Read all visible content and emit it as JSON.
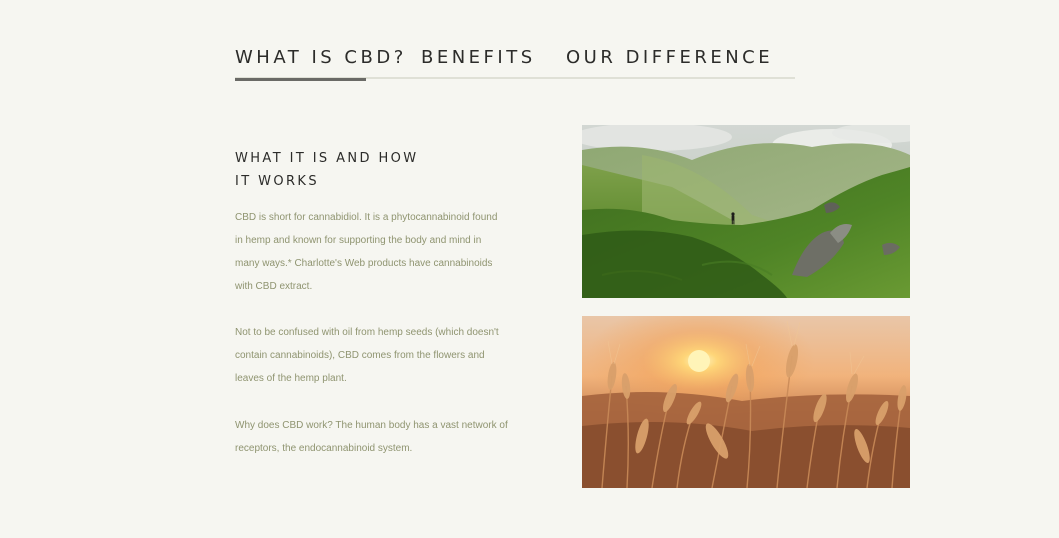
{
  "tabs": [
    {
      "label": "WHAT IS CBD?",
      "active": true
    },
    {
      "label": "BENEFITS",
      "active": false
    },
    {
      "label": "OUR DIFFERENCE",
      "active": false
    }
  ],
  "section": {
    "heading_lines": [
      "WHAT IT IS AND HOW",
      "IT WORKS"
    ],
    "paragraphs": [
      [
        "CBD is short for cannabidiol. It is a phytocannabinoid found",
        "in hemp and known for supporting the body and mind in",
        "many ways.* Charlotte's Web products have cannabinoids",
        "with CBD extract."
      ],
      [
        "Not to be confused with oil from hemp seeds (which doesn't",
        "contain cannabinoids), CBD comes from the flowers and",
        "leaves of the hemp plant."
      ],
      [
        "Why does CBD work? The human body has a vast network of",
        "receptors, the endocannabinoid system."
      ]
    ]
  },
  "colors": {
    "background": "#f6f6f1",
    "heading_text": "#2c2c2a",
    "body_text": "#8f9470",
    "tab_underline": "#dfe0d6",
    "active_tab_indicator": "#6a6a66"
  }
}
